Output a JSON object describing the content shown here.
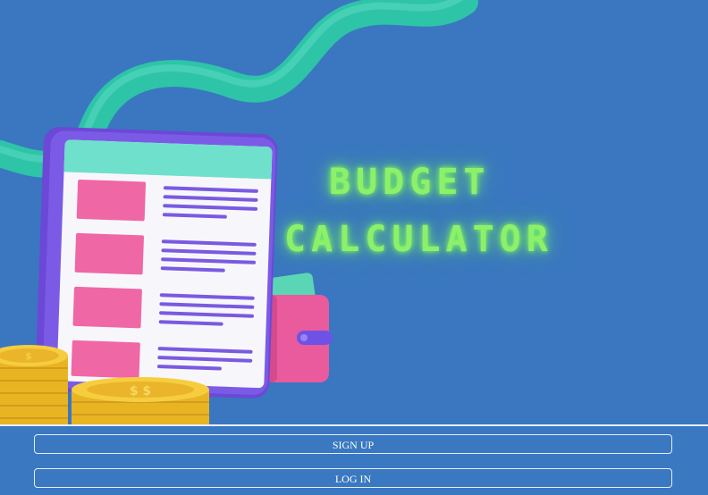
{
  "hero": {
    "title_line1": "BUDGET",
    "title_line2": "CALCULATOR"
  },
  "auth": {
    "signup_label": "SIGN UP",
    "login_label": "LOG IN"
  },
  "colors": {
    "background": "#3a78c2",
    "title_glow": "#8ef06a",
    "ribbon": "#2ec4a8",
    "document_frame": "#7a55e0",
    "coin": "#f2c230"
  },
  "icons": [
    "ribbon-decoration",
    "document-illustration",
    "wallet-icon",
    "coin-stack-icon"
  ]
}
